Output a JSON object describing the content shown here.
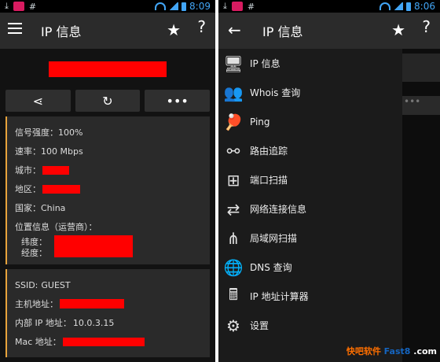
{
  "left": {
    "status_time": "8:09",
    "title": "IP 信息",
    "signal_label": "信号强度：",
    "signal_value": "100%",
    "rate_label": "速率：",
    "rate_value": "100 Mbps",
    "city_label": "城市：",
    "region_label": "地区：",
    "country_label": "国家：",
    "country_value": "China",
    "location_label": "位置信息（运营商）：",
    "lat_label": "纬度：",
    "lon_label": "经度：",
    "ssid_label": "SSID:",
    "ssid_value": "GUEST",
    "host_label": "主机地址：",
    "internal_ip_label": "内部 IP 地址：",
    "internal_ip_value": "10.0.3.15",
    "mac_label": "Mac 地址："
  },
  "right": {
    "status_time": "8:06",
    "title": "IP 信息",
    "drawer": [
      {
        "label": "IP 信息",
        "icon": "monitor-icon"
      },
      {
        "label": "Whois 查询",
        "icon": "people-icon"
      },
      {
        "label": "Ping",
        "icon": "pingpong-icon"
      },
      {
        "label": "路由追踪",
        "icon": "route-icon"
      },
      {
        "label": "端口扫描",
        "icon": "network-icon"
      },
      {
        "label": "网络连接信息",
        "icon": "connection-icon"
      },
      {
        "label": "局域网扫描",
        "icon": "lan-icon"
      },
      {
        "label": "DNS 查询",
        "icon": "globe-icon"
      },
      {
        "label": "IP 地址计算器",
        "icon": "calculator-icon"
      },
      {
        "label": "设置",
        "icon": "gear-icon"
      }
    ]
  },
  "watermark": {
    "part1": "快吧软件",
    "part2": "Fast8",
    "part3": ".com"
  },
  "colors": {
    "accent": "#e8a33c",
    "redaction": "#ff0000",
    "status_blue": "#42a5f5"
  }
}
